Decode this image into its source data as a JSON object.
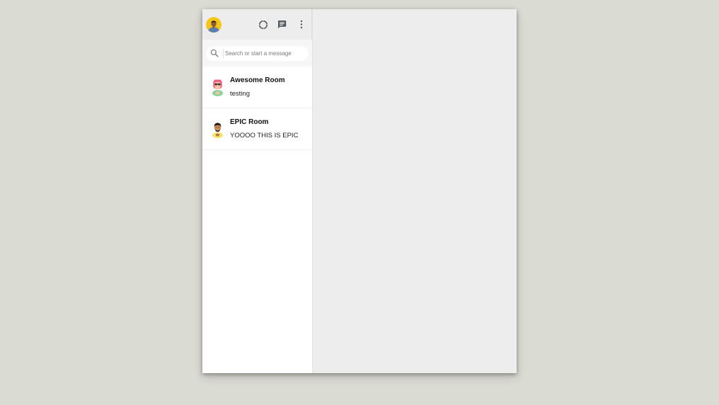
{
  "sidebar": {
    "header": {
      "avatar_icon": "user-avatar-icon",
      "icons": [
        "status-icon",
        "new-chat-icon",
        "more-vert-icon"
      ]
    },
    "search": {
      "placeholder": "Search or start a message",
      "value": ""
    },
    "chats": [
      {
        "name": "Awesome Room",
        "last_message": "testing",
        "avatar_icon": "room-avatar-icon"
      },
      {
        "name": "EPIC Room",
        "last_message": "YOOOO THIS IS EPIC",
        "avatar_icon": "room-avatar-icon"
      }
    ]
  },
  "colors": {
    "page_background": "#dadbd3",
    "header_background": "#ededed",
    "sidebar_background": "#ffffff",
    "chat_panel_background": "#ededed",
    "icon_color": "#51585c"
  }
}
